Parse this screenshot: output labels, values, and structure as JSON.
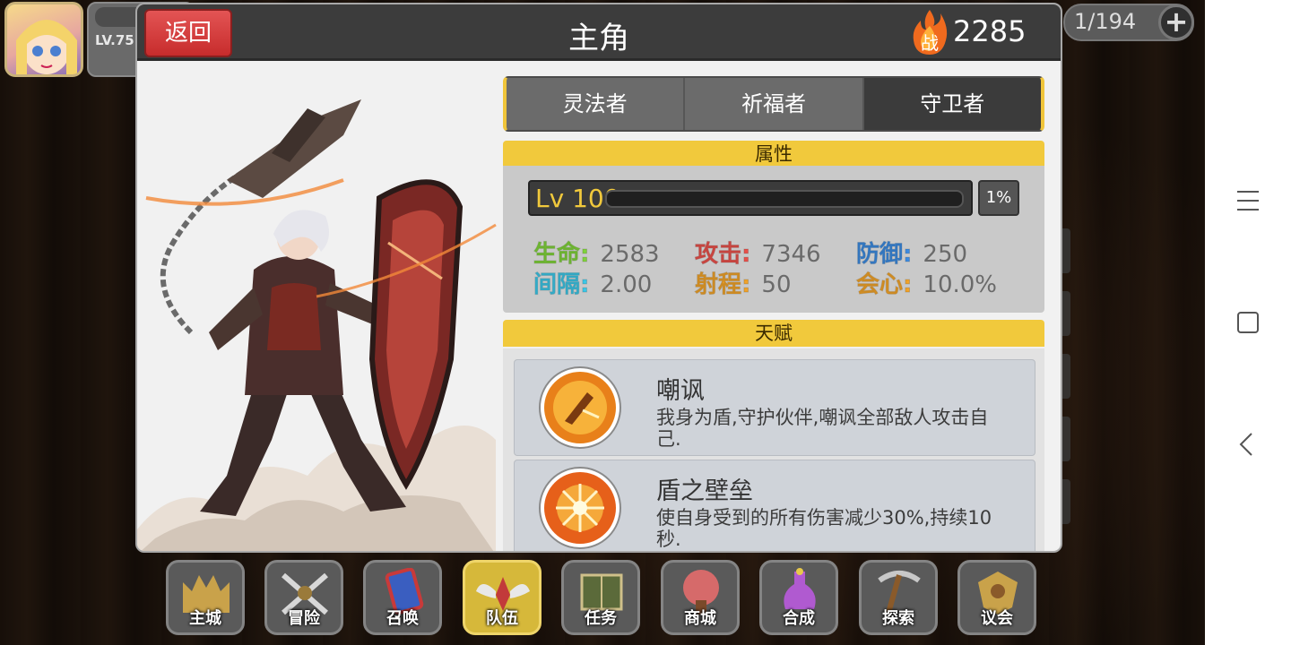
{
  "hud": {
    "level": "LV.75",
    "counter": "1/194",
    "plus_icon": "plus-icon"
  },
  "dialog": {
    "back_label": "返回",
    "title": "主角",
    "power_badge": "战",
    "power_value": "2285"
  },
  "tabs": [
    {
      "label": "灵法者",
      "active": false
    },
    {
      "label": "祈福者",
      "active": false
    },
    {
      "label": "守卫者",
      "active": true
    }
  ],
  "attributes": {
    "header": "属性",
    "level_text": "Lv 100",
    "exp_percent": "1%",
    "exp_fraction": 0.01,
    "stats": [
      {
        "label": "生命:",
        "value": "2583",
        "color": "#7fd23a"
      },
      {
        "label": "攻击:",
        "value": "7346",
        "color": "#e8504a"
      },
      {
        "label": "防御:",
        "value": "250",
        "color": "#3d8be0"
      },
      {
        "label": "间隔:",
        "value": "2.00",
        "color": "#3cc6e6"
      },
      {
        "label": "射程:",
        "value": "50",
        "color": "#f0a32a"
      },
      {
        "label": "会心:",
        "value": "10.0%",
        "color": "#f0a32a"
      }
    ]
  },
  "talents": {
    "header": "天赋",
    "items": [
      {
        "name": "嘲讽",
        "desc": "我身为盾,守护伙伴,嘲讽全部敌人攻击自己."
      },
      {
        "name": "盾之壁垒",
        "desc": "使自身受到的所有伤害减少30%,持续10秒."
      }
    ]
  },
  "menu": [
    {
      "label": "主城",
      "icon": "castle-icon",
      "active": false
    },
    {
      "label": "冒险",
      "icon": "crossed-swords-icon",
      "active": false
    },
    {
      "label": "召唤",
      "icon": "summon-card-icon",
      "active": false
    },
    {
      "label": "队伍",
      "icon": "team-wings-icon",
      "active": true
    },
    {
      "label": "任务",
      "icon": "quest-book-icon",
      "active": false
    },
    {
      "label": "商城",
      "icon": "shop-tree-icon",
      "active": false
    },
    {
      "label": "合成",
      "icon": "potion-icon",
      "active": false
    },
    {
      "label": "探索",
      "icon": "pickaxe-icon",
      "active": false
    },
    {
      "label": "议会",
      "icon": "council-crest-icon",
      "active": false
    }
  ],
  "colors": {
    "accent_yellow": "#f1c93c",
    "back_red": "#d43c3c"
  }
}
